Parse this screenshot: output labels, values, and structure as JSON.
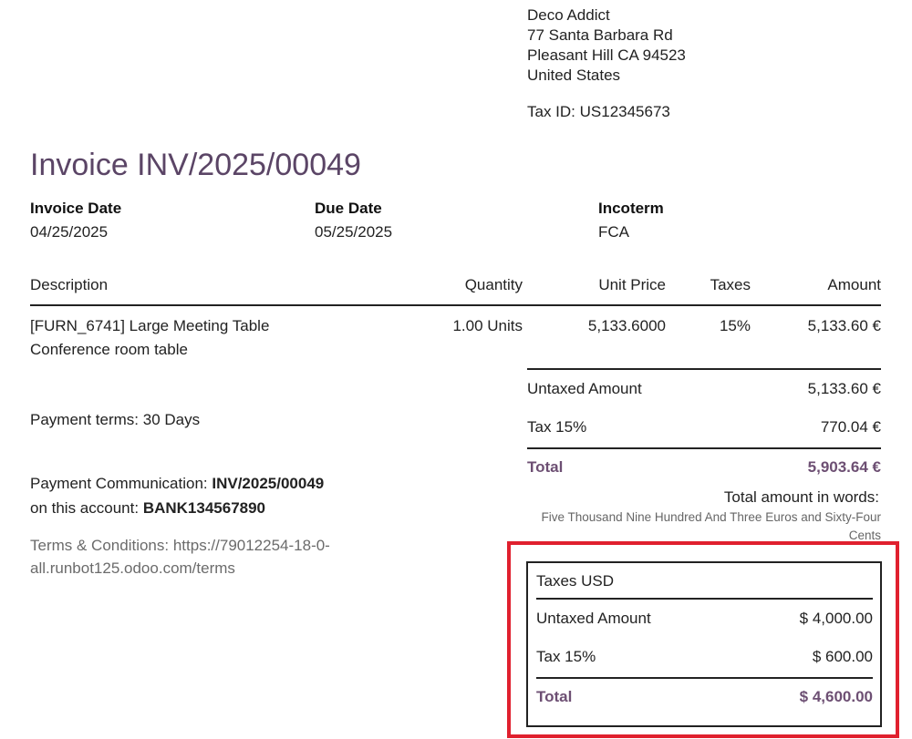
{
  "company": {
    "name": "Deco Addict",
    "street": "77 Santa Barbara Rd",
    "city_line": "Pleasant Hill CA 94523",
    "country": "United States",
    "tax_id": "Tax ID: US12345673"
  },
  "invoice": {
    "title": "Invoice INV/2025/00049",
    "invoice_date_label": "Invoice Date",
    "invoice_date": "04/25/2025",
    "due_date_label": "Due Date",
    "due_date": "05/25/2025",
    "incoterm_label": "Incoterm",
    "incoterm": "FCA"
  },
  "table": {
    "headers": {
      "description": "Description",
      "quantity": "Quantity",
      "unit_price": "Unit Price",
      "taxes": "Taxes",
      "amount": "Amount"
    },
    "rows": [
      {
        "description": "[FURN_6741] Large Meeting Table",
        "description_sub": "Conference room table",
        "quantity": "1.00 Units",
        "unit_price": "5,133.6000",
        "taxes": "15%",
        "amount": "5,133.60 €"
      }
    ]
  },
  "totals": {
    "untaxed_label": "Untaxed Amount",
    "untaxed_value": "5,133.60 €",
    "tax_label": "Tax 15%",
    "tax_value": "770.04 €",
    "total_label": "Total",
    "total_value": "5,903.64 €",
    "words_label": "Total amount in words:",
    "words_line1": "Five Thousand Nine Hundred And Three Euros and Sixty-Four",
    "words_line2": "Cents"
  },
  "notes": {
    "payment_terms": "Payment terms: 30 Days",
    "payment_comm_label": "Payment Communication: ",
    "payment_comm_value": "INV/2025/00049",
    "account_label": "on this account: ",
    "account_value": "BANK134567890",
    "terms_line1": "Terms & Conditions: https://79012254-18-0-",
    "terms_line2": "all.runbot125.odoo.com/terms"
  },
  "usd_taxes": {
    "title": "Taxes USD",
    "untaxed_label": "Untaxed Amount",
    "untaxed_value": "$ 4,000.00",
    "tax_label": "Tax 15%",
    "tax_value": "$ 600.00",
    "total_label": "Total",
    "total_value": "$ 4,600.00"
  },
  "colors": {
    "title": "#5b4566",
    "total_accent": "#6d4f73",
    "highlight_border": "#e0202e"
  }
}
